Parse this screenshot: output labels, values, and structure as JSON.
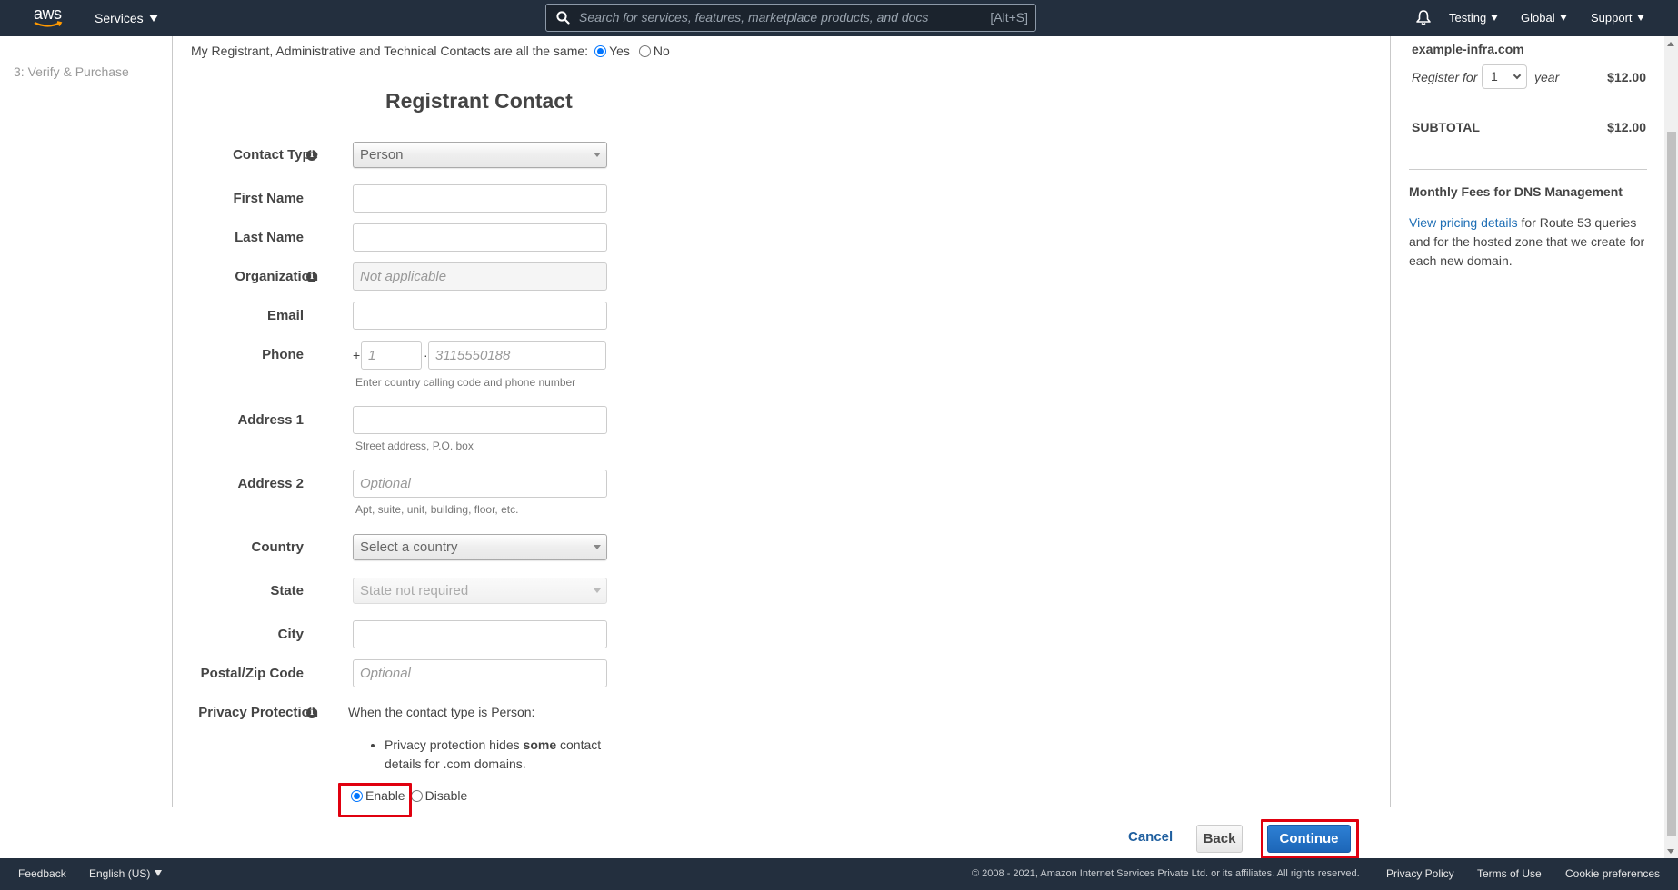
{
  "topnav": {
    "logo_text": "aws",
    "services_label": "Services",
    "search_placeholder": "Search for services, features, marketplace products, and docs",
    "search_shortcut": "[Alt+S]",
    "account_label": "Testing",
    "region_label": "Global",
    "support_label": "Support"
  },
  "sidebar": {
    "steps": [
      {
        "label": "3: Verify & Purchase"
      }
    ]
  },
  "main": {
    "same_contacts": {
      "question": "My Registrant, Administrative and Technical Contacts are all the same:",
      "options": [
        {
          "label": "Yes",
          "selected": true
        },
        {
          "label": "No",
          "selected": false
        }
      ]
    },
    "heading": "Registrant Contact",
    "fields": {
      "contact_type": {
        "label": "Contact Type",
        "value": "Person",
        "info": true
      },
      "first_name": {
        "label": "First Name",
        "value": ""
      },
      "last_name": {
        "label": "Last Name",
        "value": ""
      },
      "organization": {
        "label": "Organization",
        "placeholder": "Not applicable",
        "info": true
      },
      "email": {
        "label": "Email",
        "value": ""
      },
      "phone": {
        "label": "Phone",
        "prefix": "+",
        "separator": "·",
        "country_code_placeholder": "1",
        "number_placeholder": "3115550188",
        "hint": "Enter country calling code and phone number"
      },
      "address1": {
        "label": "Address 1",
        "value": "",
        "hint": "Street address, P.O. box"
      },
      "address2": {
        "label": "Address 2",
        "placeholder": "Optional",
        "hint": "Apt, suite, unit, building, floor, etc."
      },
      "country": {
        "label": "Country",
        "placeholder": "Select a country"
      },
      "state": {
        "label": "State",
        "placeholder": "State not required"
      },
      "city": {
        "label": "City",
        "value": ""
      },
      "postal": {
        "label": "Postal/Zip Code",
        "placeholder": "Optional"
      },
      "privacy": {
        "label": "Privacy Protection",
        "info": true,
        "description": "When the contact type is Person:",
        "bullet_pre": "Privacy protection hides ",
        "bullet_bold": "some",
        "bullet_post": " contact details for .com domains.",
        "options": [
          {
            "label": "Enable",
            "selected": true
          },
          {
            "label": "Disable",
            "selected": false
          }
        ]
      }
    },
    "actions": {
      "cancel": "Cancel",
      "back": "Back",
      "continue": "Continue"
    }
  },
  "cart": {
    "domain": "example-infra.com",
    "register_prefix": "Register for",
    "years_selected": "1",
    "register_suffix": "year",
    "register_price": "$12.00",
    "subtotal_label": "SUBTOTAL",
    "subtotal_value": "$12.00",
    "dns_title": "Monthly Fees for DNS Management",
    "dns_link": "View pricing details",
    "dns_text": " for Route 53 queries and for the hosted zone that we create for each new domain."
  },
  "footer": {
    "feedback": "Feedback",
    "language": "English (US)",
    "copyright": "© 2008 - 2021, Amazon Internet Services Private Ltd. or its affiliates. All rights reserved.",
    "privacy_policy": "Privacy Policy",
    "terms": "Terms of Use",
    "cookies": "Cookie preferences"
  },
  "colors": {
    "nav_bg": "#232f3e",
    "primary_button": "#1d66b8",
    "link": "#1f6fb5",
    "highlight_box": "#e0000f",
    "radio_selected": "#0075ff"
  }
}
